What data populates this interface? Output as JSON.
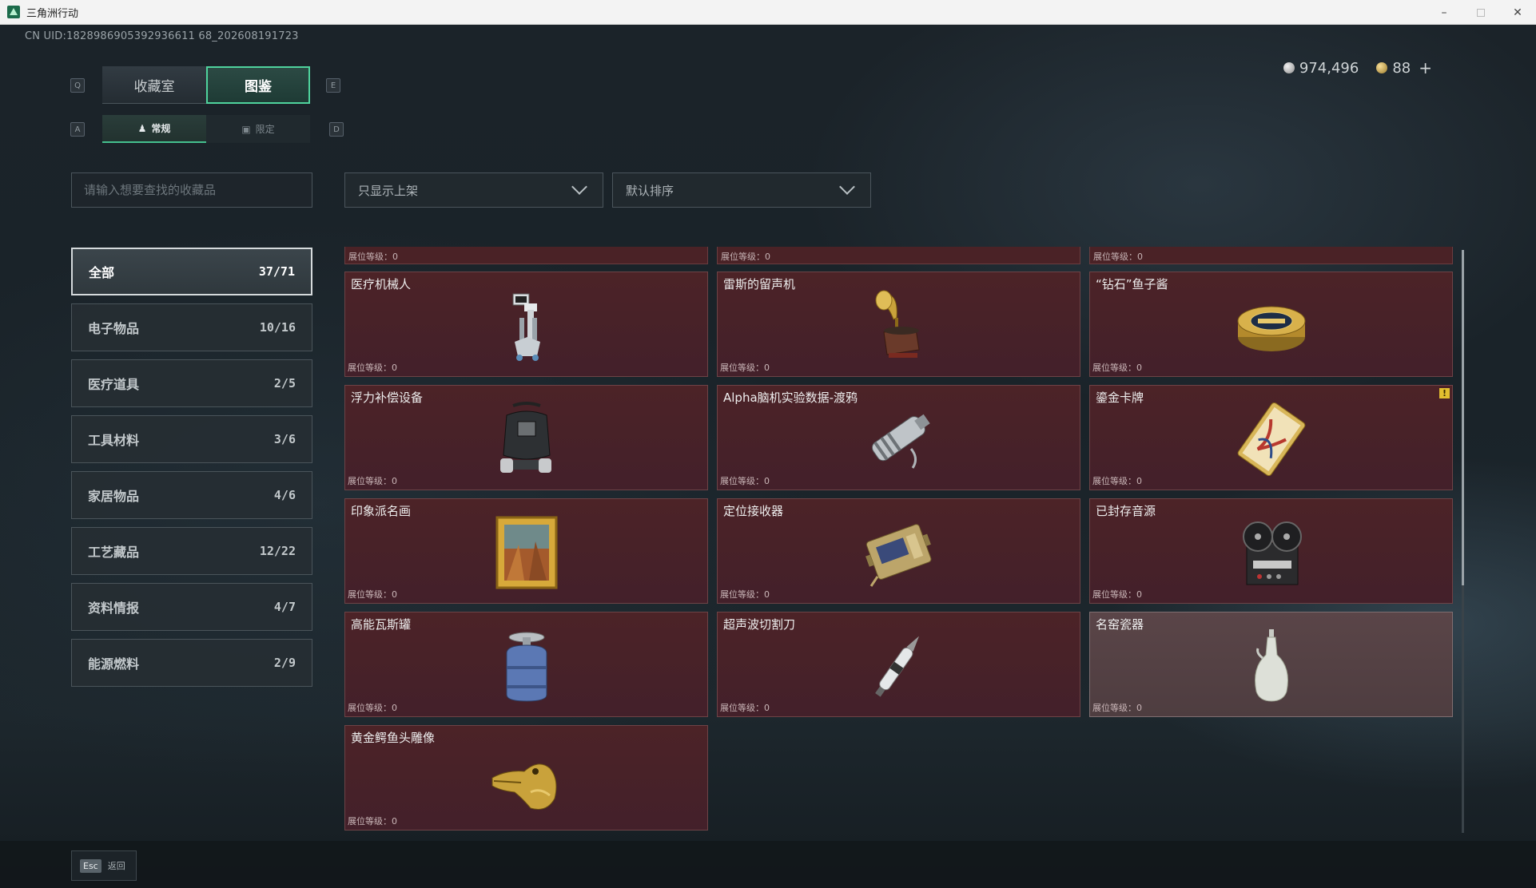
{
  "window": {
    "title": "三角洲行动"
  },
  "uid": "CN UID:1828986905392936611 68_202608191723",
  "currency": {
    "silver": "974,496",
    "gold": "88",
    "add": "+"
  },
  "keys": {
    "q": "Q",
    "e": "E",
    "a": "A",
    "d": "D"
  },
  "main_tabs": [
    {
      "label": "收藏室",
      "active": false
    },
    {
      "label": "图鉴",
      "active": true
    }
  ],
  "sub_tabs": [
    {
      "label": "常规",
      "active": true
    },
    {
      "label": "限定",
      "active": false
    }
  ],
  "search": {
    "placeholder": "请输入想要查找的收藏品"
  },
  "filters": {
    "shelf": "只显示上架",
    "sort": "默认排序"
  },
  "categories": [
    {
      "label": "全部",
      "count": "37/71",
      "active": true
    },
    {
      "label": "电子物品",
      "count": "10/16"
    },
    {
      "label": "医疗道具",
      "count": "2/5"
    },
    {
      "label": "工具材料",
      "count": "3/6"
    },
    {
      "label": "家居物品",
      "count": "4/6"
    },
    {
      "label": "工艺藏品",
      "count": "12/22"
    },
    {
      "label": "资料情报",
      "count": "4/7"
    },
    {
      "label": "能源燃料",
      "count": "2/9"
    }
  ],
  "level_label": "展位等级：0",
  "items": [
    {
      "name": "医疗机械人",
      "icon": "robot-icon"
    },
    {
      "name": "雷斯的留声机",
      "icon": "gramophone-icon"
    },
    {
      "name": "“钻石”鱼子酱",
      "icon": "caviar-tin-icon"
    },
    {
      "name": "浮力补偿设备",
      "icon": "buoyancy-device-icon"
    },
    {
      "name": "Alpha脑机实验数据-渡鸦",
      "icon": "data-canister-icon"
    },
    {
      "name": "鎏金卡牌",
      "icon": "gilded-card-icon",
      "warn": "!"
    },
    {
      "name": "印象派名画",
      "icon": "painting-icon"
    },
    {
      "name": "定位接收器",
      "icon": "receiver-icon"
    },
    {
      "name": "已封存音源",
      "icon": "reel-recorder-icon"
    },
    {
      "name": "高能瓦斯罐",
      "icon": "gas-canister-icon"
    },
    {
      "name": "超声波切割刀",
      "icon": "ultrasonic-knife-icon"
    },
    {
      "name": "名窑瓷器",
      "icon": "porcelain-vase-icon",
      "grey": true
    },
    {
      "name": "黄金鳄鱼头雕像",
      "icon": "gold-crocodile-icon"
    }
  ],
  "footer": {
    "esc_key": "Esc",
    "esc_label": "返回"
  },
  "colors": {
    "accent": "#4fd39d",
    "card": "#4c2327",
    "card_border": "#6d4346"
  }
}
